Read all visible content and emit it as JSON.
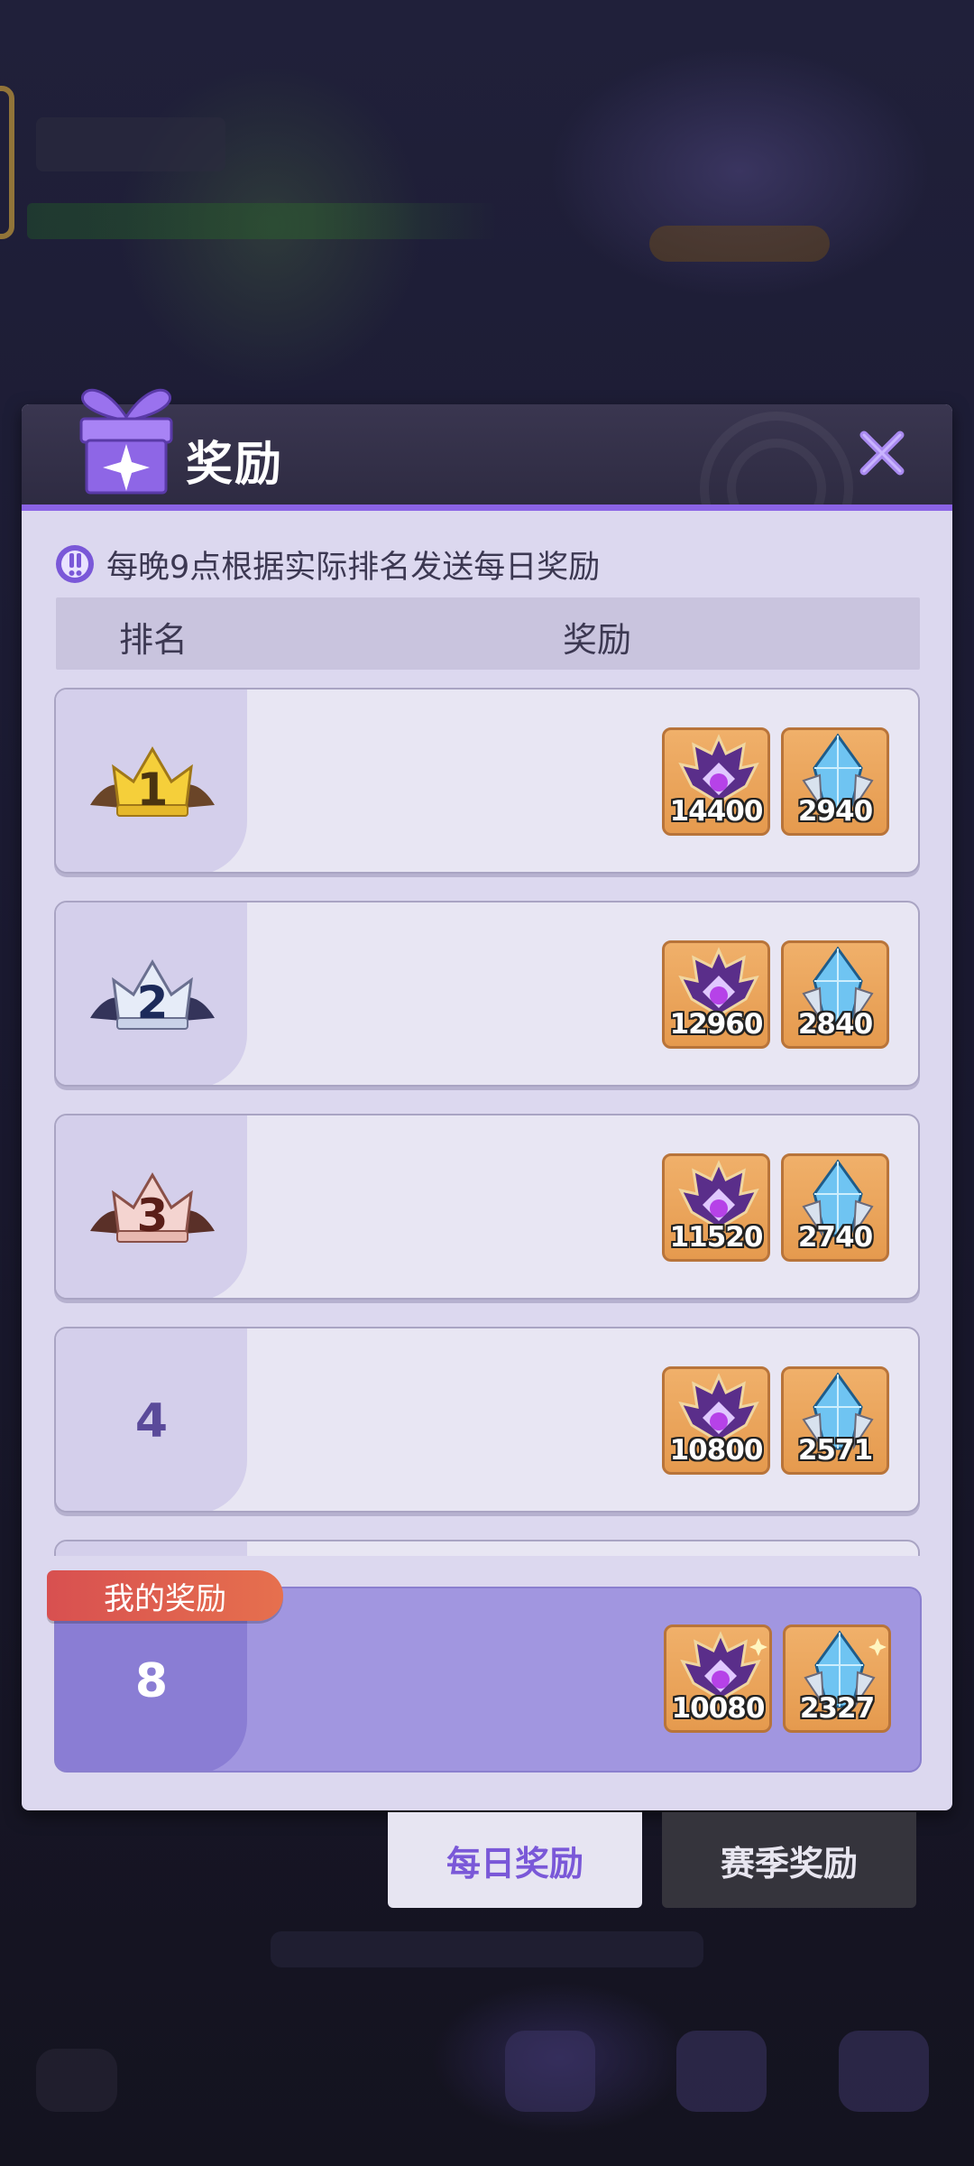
{
  "modal": {
    "title": "奖励",
    "notice": "每晚9点根据实际排名发送每日奖励",
    "columns": {
      "rank": "排名",
      "reward": "奖励"
    }
  },
  "rows": [
    {
      "rank": "1",
      "rank_style": "gold-crown",
      "rewards": [
        {
          "icon": "purple-crown-medal-icon",
          "count": "14400"
        },
        {
          "icon": "blue-crystal-icon",
          "count": "2940"
        }
      ]
    },
    {
      "rank": "2",
      "rank_style": "silver-crown",
      "rewards": [
        {
          "icon": "purple-crown-medal-icon",
          "count": "12960"
        },
        {
          "icon": "blue-crystal-icon",
          "count": "2840"
        }
      ]
    },
    {
      "rank": "3",
      "rank_style": "bronze-crown",
      "rewards": [
        {
          "icon": "purple-crown-medal-icon",
          "count": "11520"
        },
        {
          "icon": "blue-crystal-icon",
          "count": "2740"
        }
      ]
    },
    {
      "rank": "4",
      "rank_style": "number",
      "rewards": [
        {
          "icon": "purple-crown-medal-icon",
          "count": "10800"
        },
        {
          "icon": "blue-crystal-icon",
          "count": "2571"
        }
      ]
    }
  ],
  "my_reward": {
    "badge": "我的奖励",
    "rank": "8",
    "rewards": [
      {
        "icon": "purple-crown-medal-icon",
        "count": "10080"
      },
      {
        "icon": "blue-crystal-icon",
        "count": "2327"
      }
    ]
  },
  "tabs": {
    "daily": "每日奖励",
    "season": "赛季奖励"
  },
  "colors": {
    "accent": "#8b63e6",
    "panel": "#dcd8ef",
    "reward_tile": "#e59a4e",
    "badge": "#d85050"
  }
}
